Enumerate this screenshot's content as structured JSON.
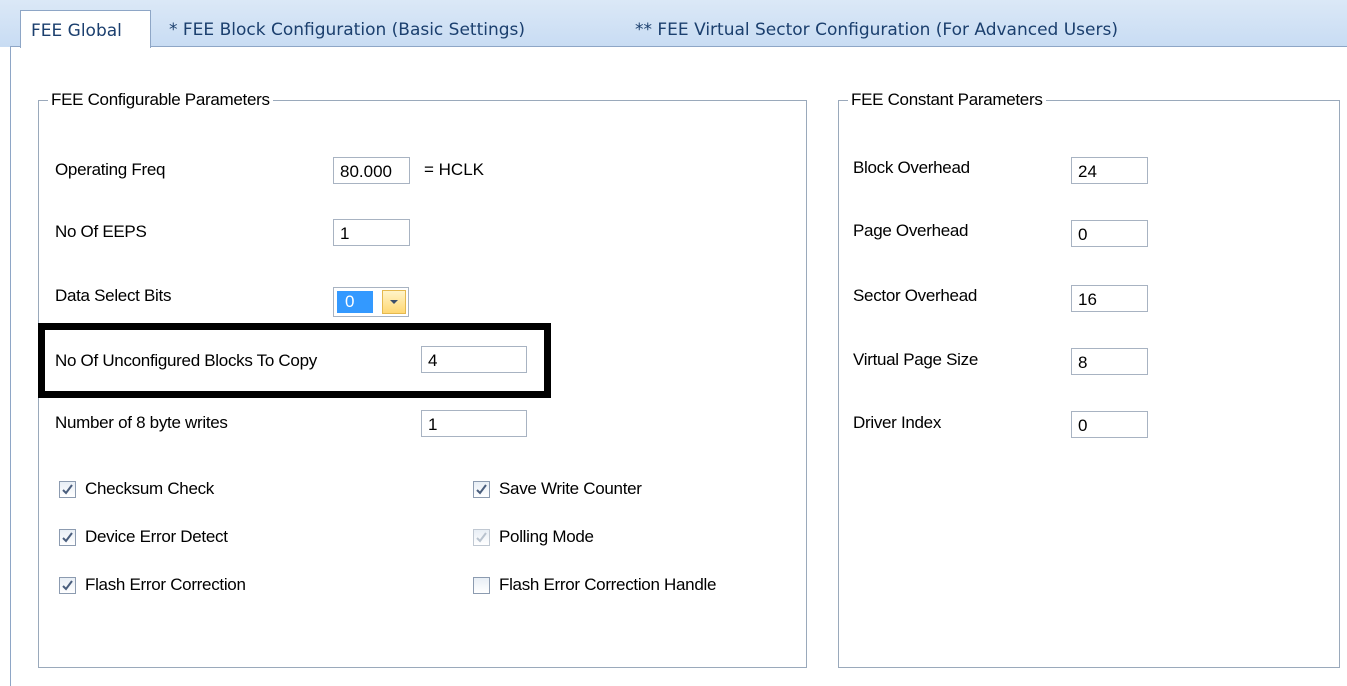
{
  "tabs": [
    {
      "label": "FEE Global",
      "active": true
    },
    {
      "label": "* FEE Block Configuration (Basic Settings)",
      "active": false
    },
    {
      "label": "** FEE Virtual Sector Configuration (For Advanced Users)",
      "active": false
    }
  ],
  "configurable": {
    "title": "FEE Configurable Parameters",
    "operating_freq": {
      "label": "Operating Freq",
      "value": "80.000",
      "suffix": "=   HCLK"
    },
    "no_of_eeps": {
      "label": "No Of EEPS",
      "value": "1"
    },
    "data_select_bits": {
      "label": "Data Select Bits",
      "value": "0"
    },
    "unconfigured_blocks": {
      "label": "No Of Unconfigured Blocks To Copy",
      "value": "4"
    },
    "byte_writes": {
      "label": "Number of 8 byte writes",
      "value": "1"
    },
    "checkboxes": {
      "checksum_check": {
        "label": "Checksum Check",
        "checked": true
      },
      "device_error_detect": {
        "label": "Device Error Detect",
        "checked": true
      },
      "flash_error_correction": {
        "label": "Flash Error Correction",
        "checked": true
      },
      "save_write_counter": {
        "label": "Save Write Counter",
        "checked": true
      },
      "polling_mode": {
        "label": "Polling Mode",
        "checked": true,
        "disabled": true
      },
      "flash_error_correction_handle": {
        "label": "Flash Error Correction Handle",
        "checked": false
      }
    }
  },
  "constant": {
    "title": "FEE Constant Parameters",
    "block_overhead": {
      "label": "Block Overhead",
      "value": "24"
    },
    "page_overhead": {
      "label": "Page Overhead",
      "value": "0"
    },
    "sector_overhead": {
      "label": "Sector Overhead",
      "value": "16"
    },
    "virtual_page_size": {
      "label": "Virtual Page Size",
      "value": "8"
    },
    "driver_index": {
      "label": "Driver Index",
      "value": "0"
    }
  },
  "colors": {
    "tab_bg": "#c8dcf3",
    "tab_text": "#1b3f6e",
    "selection": "#3399ff",
    "highlight_border": "#000000"
  }
}
